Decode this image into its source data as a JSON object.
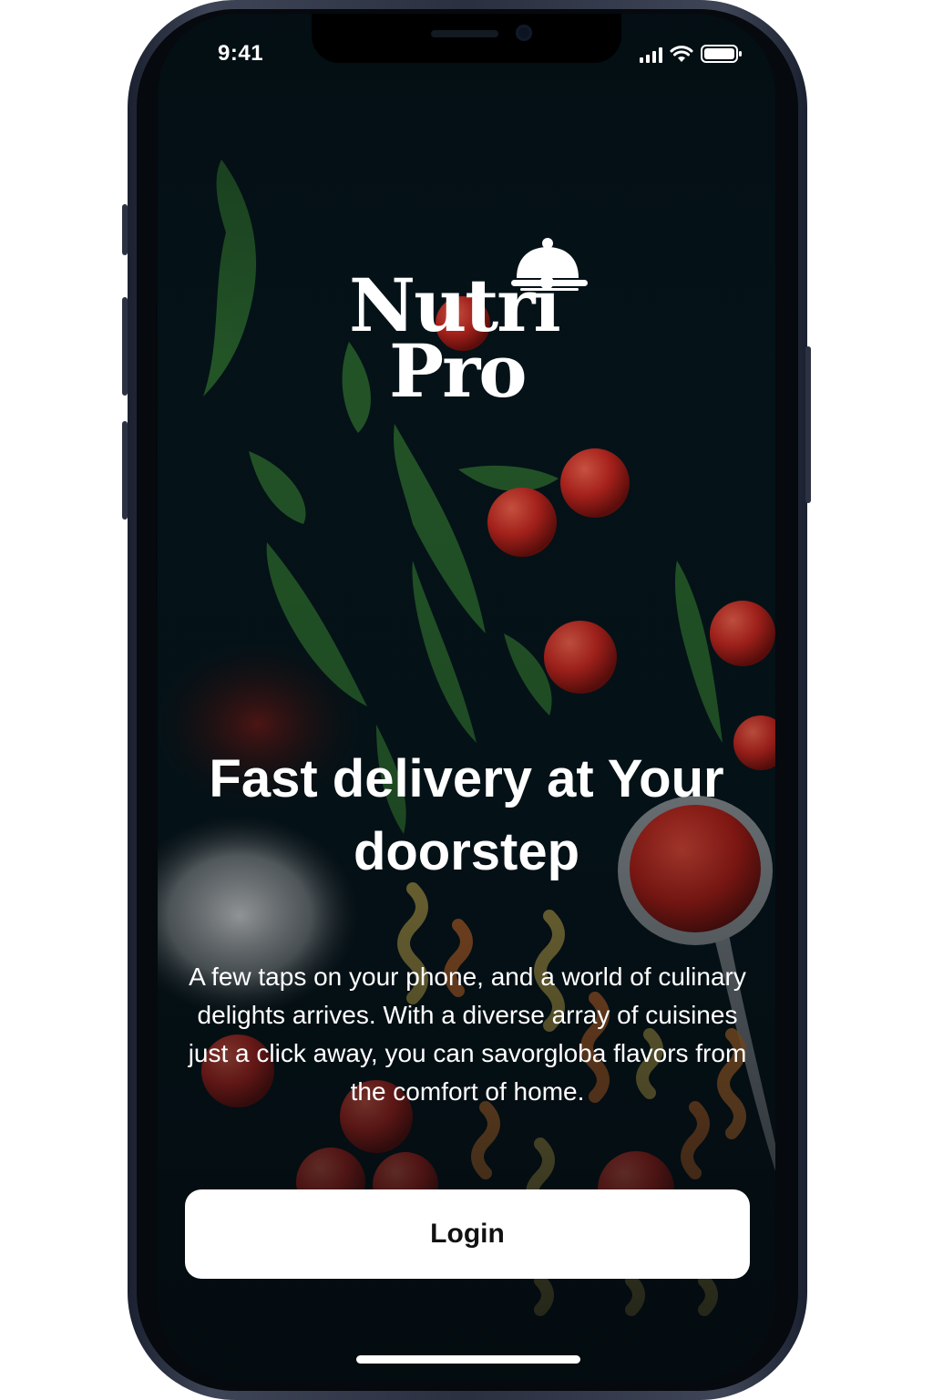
{
  "status_bar": {
    "time": "9:41",
    "icons": [
      "cellular-signal-icon",
      "wifi-icon",
      "battery-icon"
    ]
  },
  "logo": {
    "line1": "Nutri",
    "line2": "Pro",
    "icon": "cloche-icon"
  },
  "onboarding": {
    "headline": "Fast delivery at Your doorstep",
    "description": "A few taps on your phone, and a world of culinary delights arrives. With a diverse array of cuisines just a click away, you can savorgloba flavors from the comfort of home."
  },
  "actions": {
    "login_label": "Login"
  },
  "colors": {
    "background": "#05141a",
    "text": "#ffffff",
    "button_background": "#ffffff",
    "button_text": "#111111",
    "tomato": "#c8261e",
    "greens": "#2f6e2e"
  }
}
